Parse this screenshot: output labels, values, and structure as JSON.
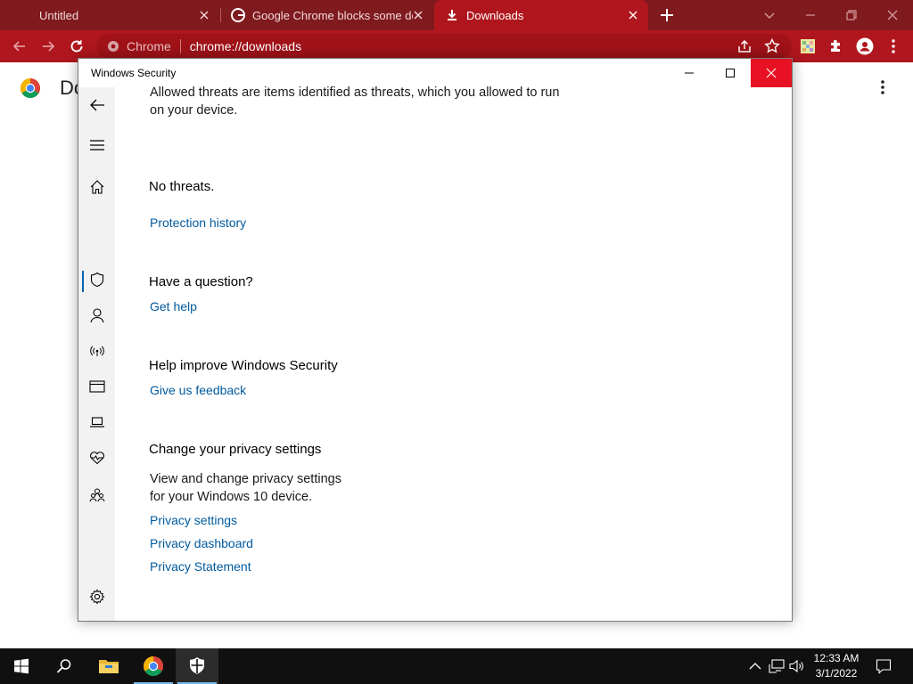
{
  "browser": {
    "tabs": [
      {
        "title": "Untitled",
        "active": false
      },
      {
        "title": "Google Chrome blocks some dow",
        "active": false
      },
      {
        "title": "Downloads",
        "active": true
      }
    ],
    "omnibox": {
      "site_chip": "Chrome",
      "url": "chrome://downloads"
    },
    "page_title": "Do",
    "colors": {
      "frame": "#7f1a1e",
      "toolbar": "#b0161d"
    }
  },
  "security_window": {
    "title": "Windows Security",
    "intro_line1": "Allowed threats are items identified as threats, which you allowed to run",
    "intro_line2": "on your device.",
    "no_threats": "No threats.",
    "protection_history_link": "Protection history",
    "question_heading": "Have a question?",
    "get_help_link": "Get help",
    "improve_heading": "Help improve Windows Security",
    "feedback_link": "Give us feedback",
    "privacy_heading": "Change your privacy settings",
    "privacy_desc_line1": "View and change privacy settings",
    "privacy_desc_line2": "for your Windows 10 device.",
    "privacy_settings_link": "Privacy settings",
    "privacy_dashboard_link": "Privacy dashboard",
    "privacy_statement_link": "Privacy Statement",
    "nav_icons": [
      "back-arrow-icon",
      "hamburger-menu-icon",
      "home-icon",
      "shield-icon",
      "account-icon",
      "firewall-network-icon",
      "app-browser-control-icon",
      "device-security-icon",
      "device-health-icon",
      "family-options-icon",
      "settings-gear-icon"
    ],
    "colors": {
      "link": "#005a9e",
      "close_button": "#e81123",
      "nav_active": "#0063b1"
    }
  },
  "taskbar": {
    "time": "12:33 AM",
    "date": "3/1/2022",
    "items": [
      "start-icon",
      "search-icon",
      "file-explorer-icon",
      "chrome-icon",
      "windows-security-icon"
    ]
  }
}
